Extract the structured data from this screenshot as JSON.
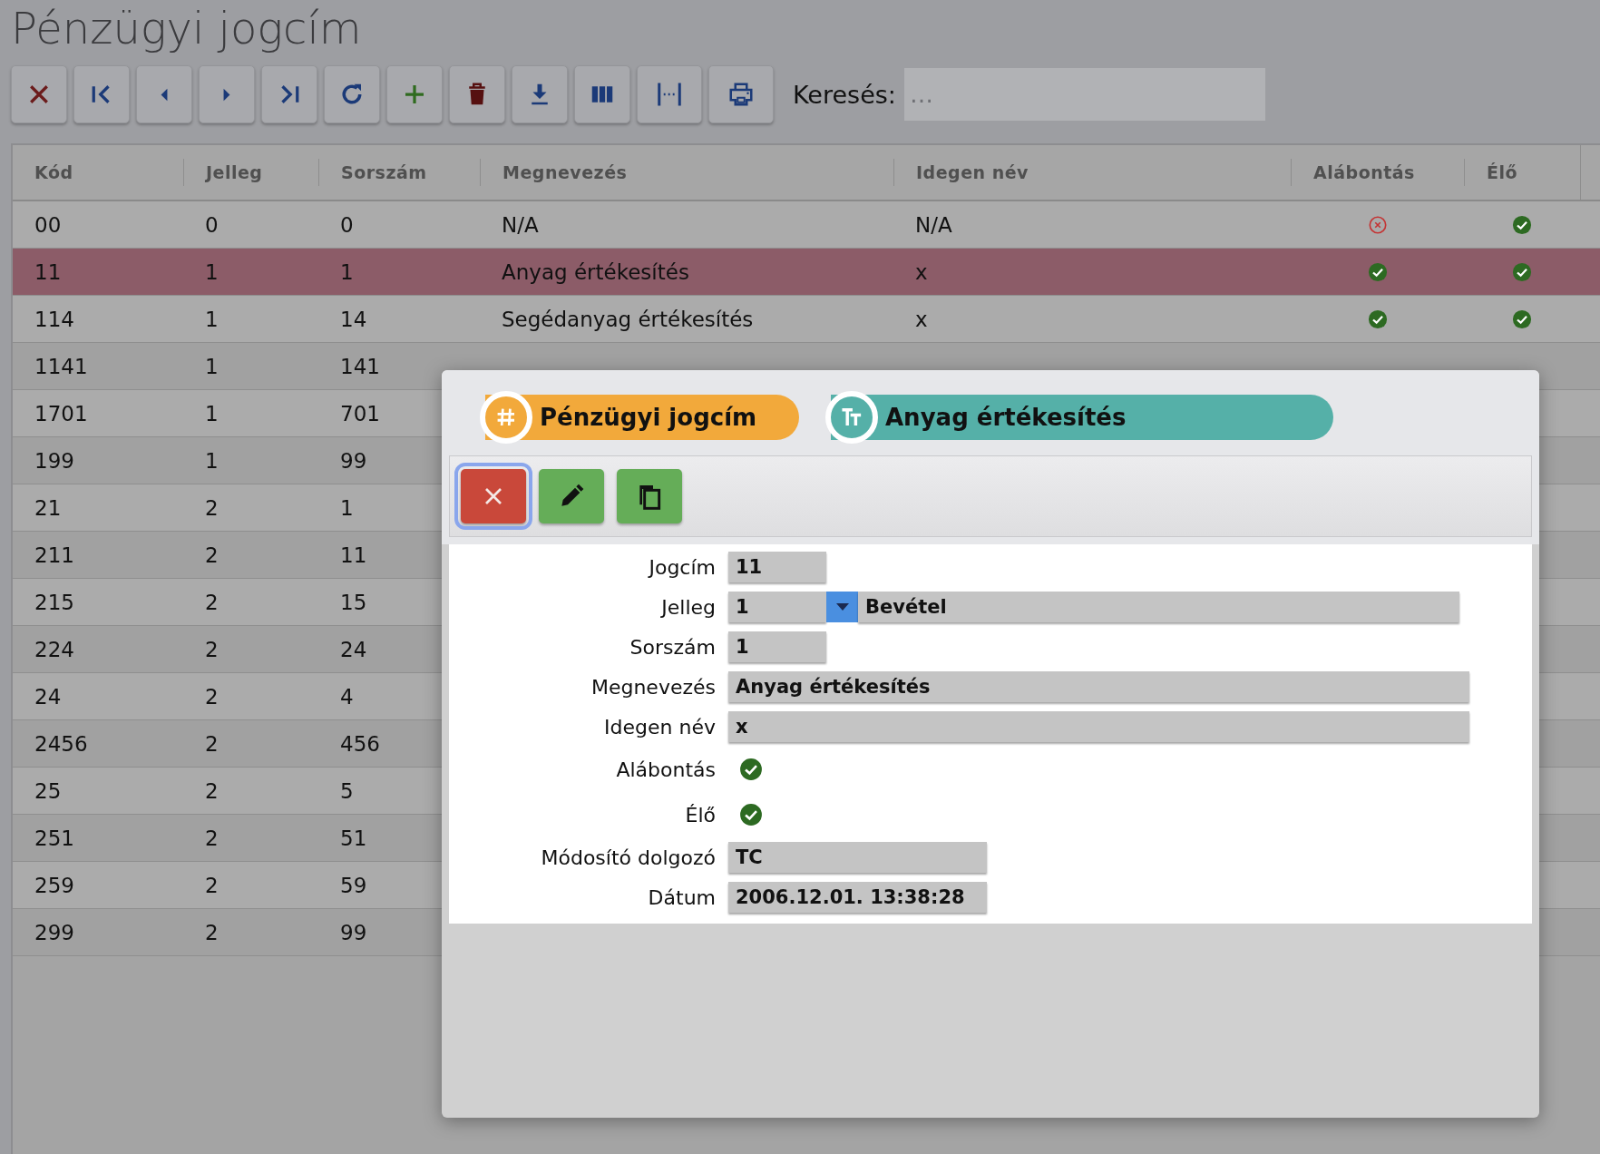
{
  "page": {
    "title": "Pénzügyi jogcím"
  },
  "toolbar": {
    "buttons": [
      {
        "kind": "close"
      },
      {
        "kind": "first"
      },
      {
        "kind": "prev"
      },
      {
        "kind": "next"
      },
      {
        "kind": "last"
      },
      {
        "kind": "refresh"
      },
      {
        "kind": "add"
      },
      {
        "kind": "delete"
      },
      {
        "kind": "download"
      },
      {
        "kind": "columns"
      },
      {
        "kind": "fit"
      },
      {
        "kind": "print"
      }
    ],
    "search": {
      "label": "Keresés:",
      "placeholder": "…"
    }
  },
  "table": {
    "columns": [
      "Kód",
      "Jelleg",
      "Sorszám",
      "Megnevezés",
      "Idegen név",
      "Alábontás",
      "Élő"
    ],
    "rows": [
      {
        "cells": [
          "00",
          "0",
          "0",
          "N/A",
          "N/A"
        ],
        "alabontas": false,
        "elo": true,
        "selected": false
      },
      {
        "cells": [
          "11",
          "1",
          "1",
          "Anyag értékesítés",
          "x"
        ],
        "alabontas": true,
        "elo": true,
        "selected": true
      },
      {
        "cells": [
          "114",
          "1",
          "14",
          "Segédanyag értékesítés",
          "x"
        ],
        "alabontas": true,
        "elo": true,
        "selected": false
      },
      {
        "cells": [
          "1141",
          "1",
          "141"
        ],
        "selected": false
      },
      {
        "cells": [
          "1701",
          "1",
          "701"
        ],
        "selected": false
      },
      {
        "cells": [
          "199",
          "1",
          "99"
        ],
        "selected": false
      },
      {
        "cells": [
          "21",
          "2",
          "1"
        ],
        "selected": false
      },
      {
        "cells": [
          "211",
          "2",
          "11"
        ],
        "selected": false
      },
      {
        "cells": [
          "215",
          "2",
          "15"
        ],
        "selected": false
      },
      {
        "cells": [
          "224",
          "2",
          "24"
        ],
        "selected": false
      },
      {
        "cells": [
          "24",
          "2",
          "4"
        ],
        "selected": false
      },
      {
        "cells": [
          "2456",
          "2",
          "456"
        ],
        "selected": false
      },
      {
        "cells": [
          "25",
          "2",
          "5"
        ],
        "selected": false
      },
      {
        "cells": [
          "251",
          "2",
          "51"
        ],
        "selected": false
      },
      {
        "cells": [
          "259",
          "2",
          "59"
        ],
        "selected": false
      },
      {
        "cells": [
          "299",
          "2",
          "99"
        ],
        "selected": false
      }
    ]
  },
  "dialog": {
    "tags": [
      {
        "kind": "hash",
        "label": "Pénzügyi jogcím",
        "color": "#f2a93b"
      },
      {
        "kind": "text",
        "label": "Anyag értékesítés",
        "color": "#55b0a8"
      }
    ],
    "actions": [
      {
        "kind": "cancel",
        "focused": true
      },
      {
        "kind": "edit",
        "focused": false
      },
      {
        "kind": "copy",
        "focused": false
      }
    ],
    "fields": [
      {
        "kind": "short",
        "label": "Jogcím",
        "value": "11"
      },
      {
        "kind": "select",
        "label": "Jelleg",
        "value": "1",
        "option": "Bevétel"
      },
      {
        "kind": "short",
        "label": "Sorszám",
        "value": "1"
      },
      {
        "kind": "wide",
        "label": "Megnevezés",
        "value": "Anyag értékesítés"
      },
      {
        "kind": "wide",
        "label": "Idegen név",
        "value": "x"
      },
      {
        "kind": "check",
        "label": "Alábontás",
        "checked": true
      },
      {
        "kind": "check",
        "label": "Élő",
        "checked": true
      },
      {
        "kind": "medium",
        "label": "Módosító dolgozó",
        "value": "TC"
      },
      {
        "kind": "medium",
        "label": "Dátum",
        "value": "2006.12.01. 13:38:28"
      }
    ]
  }
}
